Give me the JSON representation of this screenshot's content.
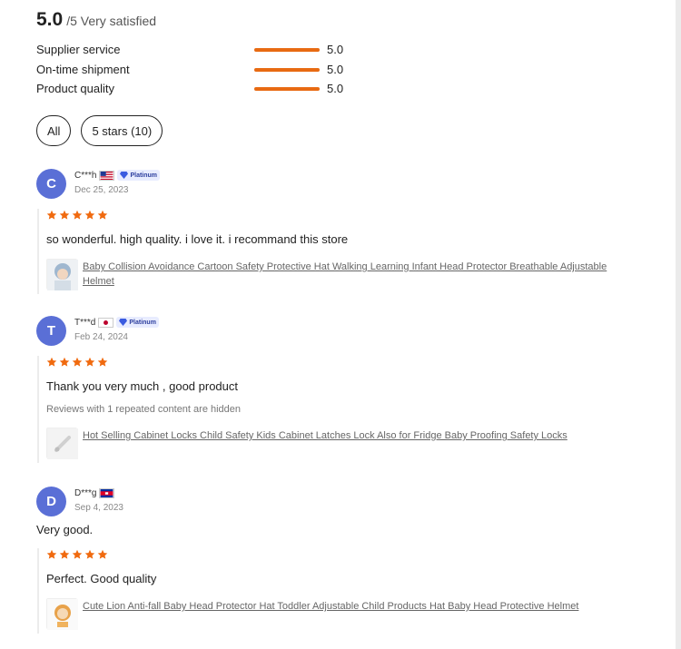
{
  "summary": {
    "score": "5.0",
    "suffix": "/5 Very satisfied"
  },
  "metrics": [
    {
      "label": "Supplier service",
      "value": "5.0",
      "fill": 1.0
    },
    {
      "label": "On-time shipment",
      "value": "5.0",
      "fill": 1.0
    },
    {
      "label": "Product quality",
      "value": "5.0",
      "fill": 1.0
    }
  ],
  "filters": [
    {
      "label": "All"
    },
    {
      "label": "5 stars (10)"
    }
  ],
  "colors": {
    "accent": "#e86a12",
    "avatar": "#5a6fd6",
    "star": "#f06a0f"
  },
  "reviews": [
    {
      "initial": "C",
      "name": "C***h",
      "flag": "us-flag-icon",
      "badge": "Platinum",
      "date": "Dec 25, 2023",
      "rating": 5,
      "comment": "so wonderful. high quality. i love it. i recommand this store",
      "product": "Baby Collision Avoidance Cartoon Safety Protective Hat Walking Learning Infant Head Protector Breathable Adjustable Helmet"
    },
    {
      "initial": "T",
      "name": "T***d",
      "flag": "jp-flag-icon",
      "badge": "Platinum",
      "date": "Feb 24, 2024",
      "rating": 5,
      "comment": "Thank you very much , good product",
      "note": "Reviews with 1 repeated content are hidden",
      "product": "Hot Selling Cabinet Locks Child Safety Kids Cabinet Latches Lock Also for Fridge Baby Proofing Safety Locks"
    },
    {
      "initial": "D",
      "name": "D***g",
      "flag": "kh-flag-icon",
      "date": "Sep 4, 2023",
      "rating": 5,
      "extra_comment": "Very good.",
      "comment": "Perfect. Good quality",
      "product": "Cute Lion Anti-fall Baby Head Protector Hat Toddler Adjustable Child Products Hat Baby Head Protective Helmet"
    }
  ]
}
